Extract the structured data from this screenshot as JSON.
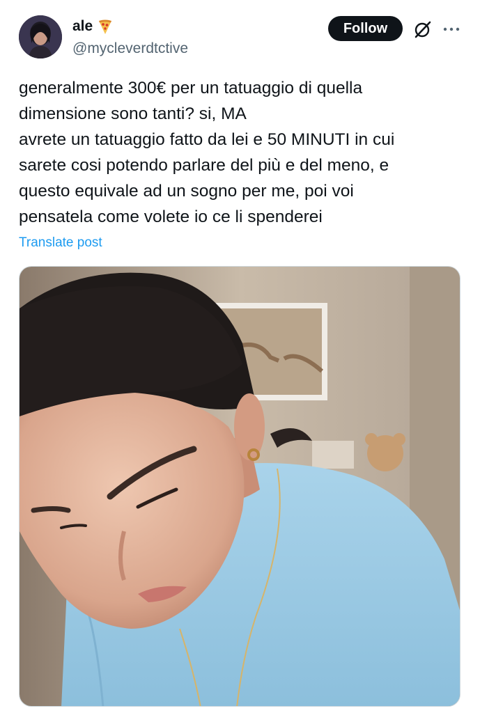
{
  "tweet": {
    "author": {
      "display_name": "ale",
      "name_emoji": "pizza",
      "handle": "@mycleverdtctive"
    },
    "follow_label": "Follow",
    "icons": {
      "grok": "grok-icon",
      "more": "more-icon"
    },
    "text_lines": [
      "generalmente 300€ per un tatuaggio di quella",
      "dimensione sono tanti? si, MA",
      "avrete un tatuaggio fatto da lei e 50 MINUTI in cui",
      "sarete cosi potendo parlare del più e del meno, e",
      "questo equivale ad un sogno per me, poi voi",
      "pensatela come volete io ce li spenderei"
    ],
    "translate_label": "Translate post",
    "media": {
      "type": "photo"
    }
  },
  "colors": {
    "text": "#0f1419",
    "secondary": "#536471",
    "link": "#1d9bf0",
    "follow_bg": "#0f1419"
  }
}
